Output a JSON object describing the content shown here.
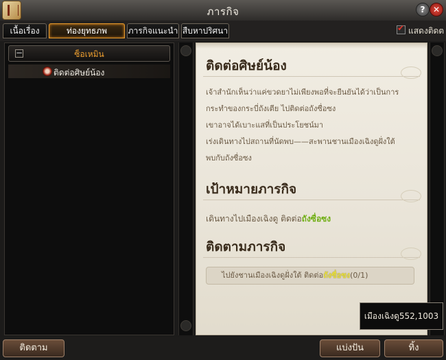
{
  "window": {
    "title": "ภารกิจ"
  },
  "tabs": [
    {
      "label": "เนื้อเรื่อง",
      "active": false
    },
    {
      "label": "ท่องยุทธภพ",
      "active": true
    },
    {
      "label": "ภารกิจแนะนำ",
      "active": false
    },
    {
      "label": "สืบหาปริศนา",
      "active": false
    }
  ],
  "show_tracking": {
    "label": "แสดงติดต",
    "checked": true
  },
  "quest_list": {
    "group_label": "ซ็อเหมิน",
    "group_toggle": "−",
    "items": [
      {
        "label": "ติดต่อศิษย์น้อง",
        "icon": "quest-seal-icon"
      }
    ]
  },
  "quest_detail": {
    "title": "ติดต่อศิษย์น้อง",
    "description": [
      "เจ้าสำนักเห็นว่าแค่ขวดยาไม่เพียงพอที่จะยืนยันได้ว่าเป็นการ",
      "กระทำของกระบี่ถังเตีย ไปติดต่อถังซื่อซง",
      "เขาอาจได้เบาะแสที่เป็นประโยชน์มา",
      "เร่งเดินทางไปสถานที่นัดพบ——สะพานชานเมืองเฉิงดูฝั่งใต้",
      "พบกับถังซื่อซง"
    ],
    "objective_heading": "เป้าหมายภารกิจ",
    "objective_text": "เดินทางไปเมืองเฉิงดู ติดต่อ",
    "objective_target": "ถังซื่อซง",
    "tracking_heading": "ติดตามภารกิจ",
    "tracking_text": "ไปยังชานเมืองเฉิงดูฝั่งใต้ ติดต่อ",
    "tracking_target": "ถังซื่อซง",
    "tracking_progress": "(0/1)"
  },
  "coordinate_tooltip": "เมืองเฉิงดู552,1003",
  "buttons": {
    "track": "ติดตาม",
    "share": "แบ่งปัน",
    "abandon": "ทิ้ง"
  },
  "colors": {
    "tab_active_border": "#e59a2d",
    "group_label": "#f0a030",
    "highlight": "#6fae13",
    "close": "#e0473b"
  }
}
